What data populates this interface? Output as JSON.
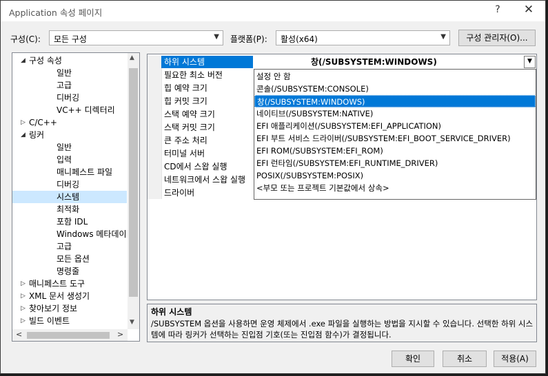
{
  "window": {
    "title": "Application 속성 페이지",
    "help_glyph": "?",
    "close_glyph": "✕"
  },
  "config": {
    "config_label": "구성(C):",
    "config_value": "모든 구성",
    "platform_label": "플랫폼(P):",
    "platform_value": "활성(x64)",
    "manager_button": "구성 관리자(O)..."
  },
  "tree": {
    "items": [
      {
        "label": "구성 속성",
        "expander": "◢"
      },
      {
        "label": "일반"
      },
      {
        "label": "고급"
      },
      {
        "label": "디버깅"
      },
      {
        "label": "VC++ 디렉터리"
      },
      {
        "label": "C/C++",
        "expander": "▷"
      },
      {
        "label": "링커",
        "expander": "◢"
      },
      {
        "label": "일반"
      },
      {
        "label": "입력"
      },
      {
        "label": "매니페스트 파일"
      },
      {
        "label": "디버깅"
      },
      {
        "label": "시스템"
      },
      {
        "label": "최적화"
      },
      {
        "label": "포함 IDL"
      },
      {
        "label": "Windows 메타데이"
      },
      {
        "label": "고급"
      },
      {
        "label": "모든 옵션"
      },
      {
        "label": "명령줄"
      },
      {
        "label": "매니페스트 도구",
        "expander": "▷"
      },
      {
        "label": "XML 문서 생성기",
        "expander": "▷"
      },
      {
        "label": "찾아보기 정보",
        "expander": "▷"
      },
      {
        "label": "빌드 이벤트",
        "expander": "▷"
      }
    ],
    "selected": "시스템"
  },
  "properties": {
    "rows": [
      {
        "name": "하위 시스템"
      },
      {
        "name": "필요한 최소 버전"
      },
      {
        "name": "힙 예약 크기"
      },
      {
        "name": "힙 커밋 크기"
      },
      {
        "name": "스택 예약 크기"
      },
      {
        "name": "스택 커밋 크기"
      },
      {
        "name": "큰 주소 처리"
      },
      {
        "name": "터미널 서버"
      },
      {
        "name": "CD에서 스왑 실행"
      },
      {
        "name": "네트워크에서 스왑 실행"
      },
      {
        "name": "드라이버"
      }
    ],
    "current_value": "창(/SUBSYSTEM:WINDOWS)"
  },
  "dropdown": {
    "options": [
      {
        "label": "설정 안 함"
      },
      {
        "label": "콘솔(/SUBSYSTEM:CONSOLE)"
      },
      {
        "label": "창(/SUBSYSTEM:WINDOWS)"
      },
      {
        "label": "네이티브(/SUBSYSTEM:NATIVE)"
      },
      {
        "label": "EFI 애플리케이션(/SUBSYSTEM:EFI_APPLICATION)"
      },
      {
        "label": "EFI 부트 서비스 드라이버(/SUBSYSTEM:EFI_BOOT_SERVICE_DRIVER)"
      },
      {
        "label": "EFI ROM(/SUBSYSTEM:EFI_ROM)"
      },
      {
        "label": "EFI 런타임(/SUBSYSTEM:EFI_RUNTIME_DRIVER)"
      },
      {
        "label": "POSIX(/SUBSYSTEM:POSIX)"
      },
      {
        "label": "<부모 또는 프로젝트 기본값에서 상속>"
      }
    ],
    "selected": "창(/SUBSYSTEM:WINDOWS)"
  },
  "description": {
    "title": "하위 시스템",
    "text": "/SUBSYSTEM 옵션을 사용하면 운영 체제에서 .exe 파일을 실행하는 방법을 지시할 수 있습니다. 선택한 하위 시스템에 따라 링커가 선택하는 진입점 기호(또는 진입점 함수)가 결정됩니다."
  },
  "buttons": {
    "ok": "확인",
    "cancel": "취소",
    "apply": "적용(A)"
  }
}
